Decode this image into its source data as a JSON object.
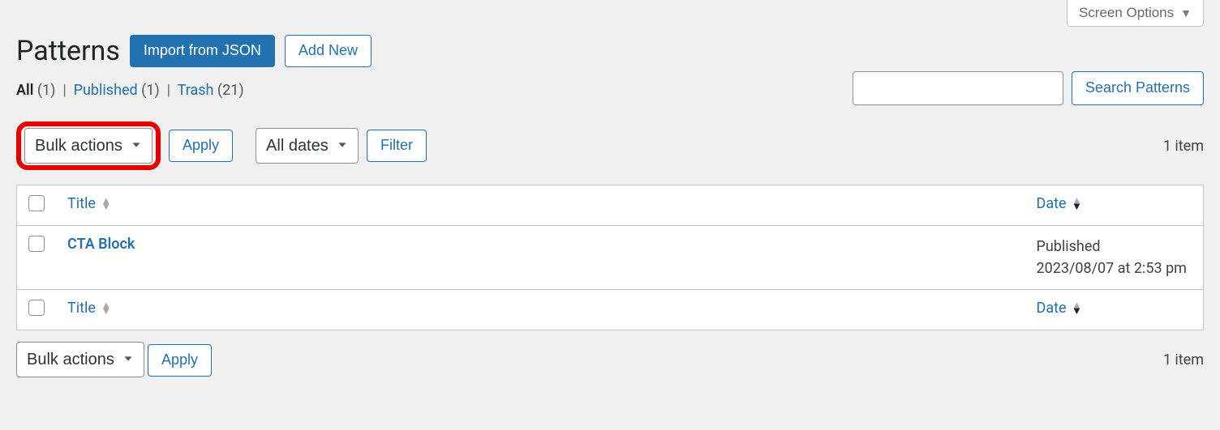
{
  "screen_options": {
    "label": "Screen Options"
  },
  "page": {
    "title": "Patterns",
    "import_button": "Import from JSON",
    "add_new_button": "Add New"
  },
  "views": {
    "all": {
      "label": "All",
      "count": "(1)"
    },
    "published": {
      "label": "Published",
      "count": "(1)"
    },
    "trash": {
      "label": "Trash",
      "count": "(21)"
    }
  },
  "search": {
    "button": "Search Patterns"
  },
  "bulk": {
    "select_label": "Bulk actions",
    "apply": "Apply"
  },
  "date_filter": {
    "select_label": "All dates",
    "filter": "Filter"
  },
  "pagination": {
    "count": "1 item"
  },
  "columns": {
    "title": "Title",
    "date": "Date"
  },
  "rows": [
    {
      "title": "CTA Block",
      "status": "Published",
      "datetime": "2023/08/07 at 2:53 pm"
    }
  ]
}
